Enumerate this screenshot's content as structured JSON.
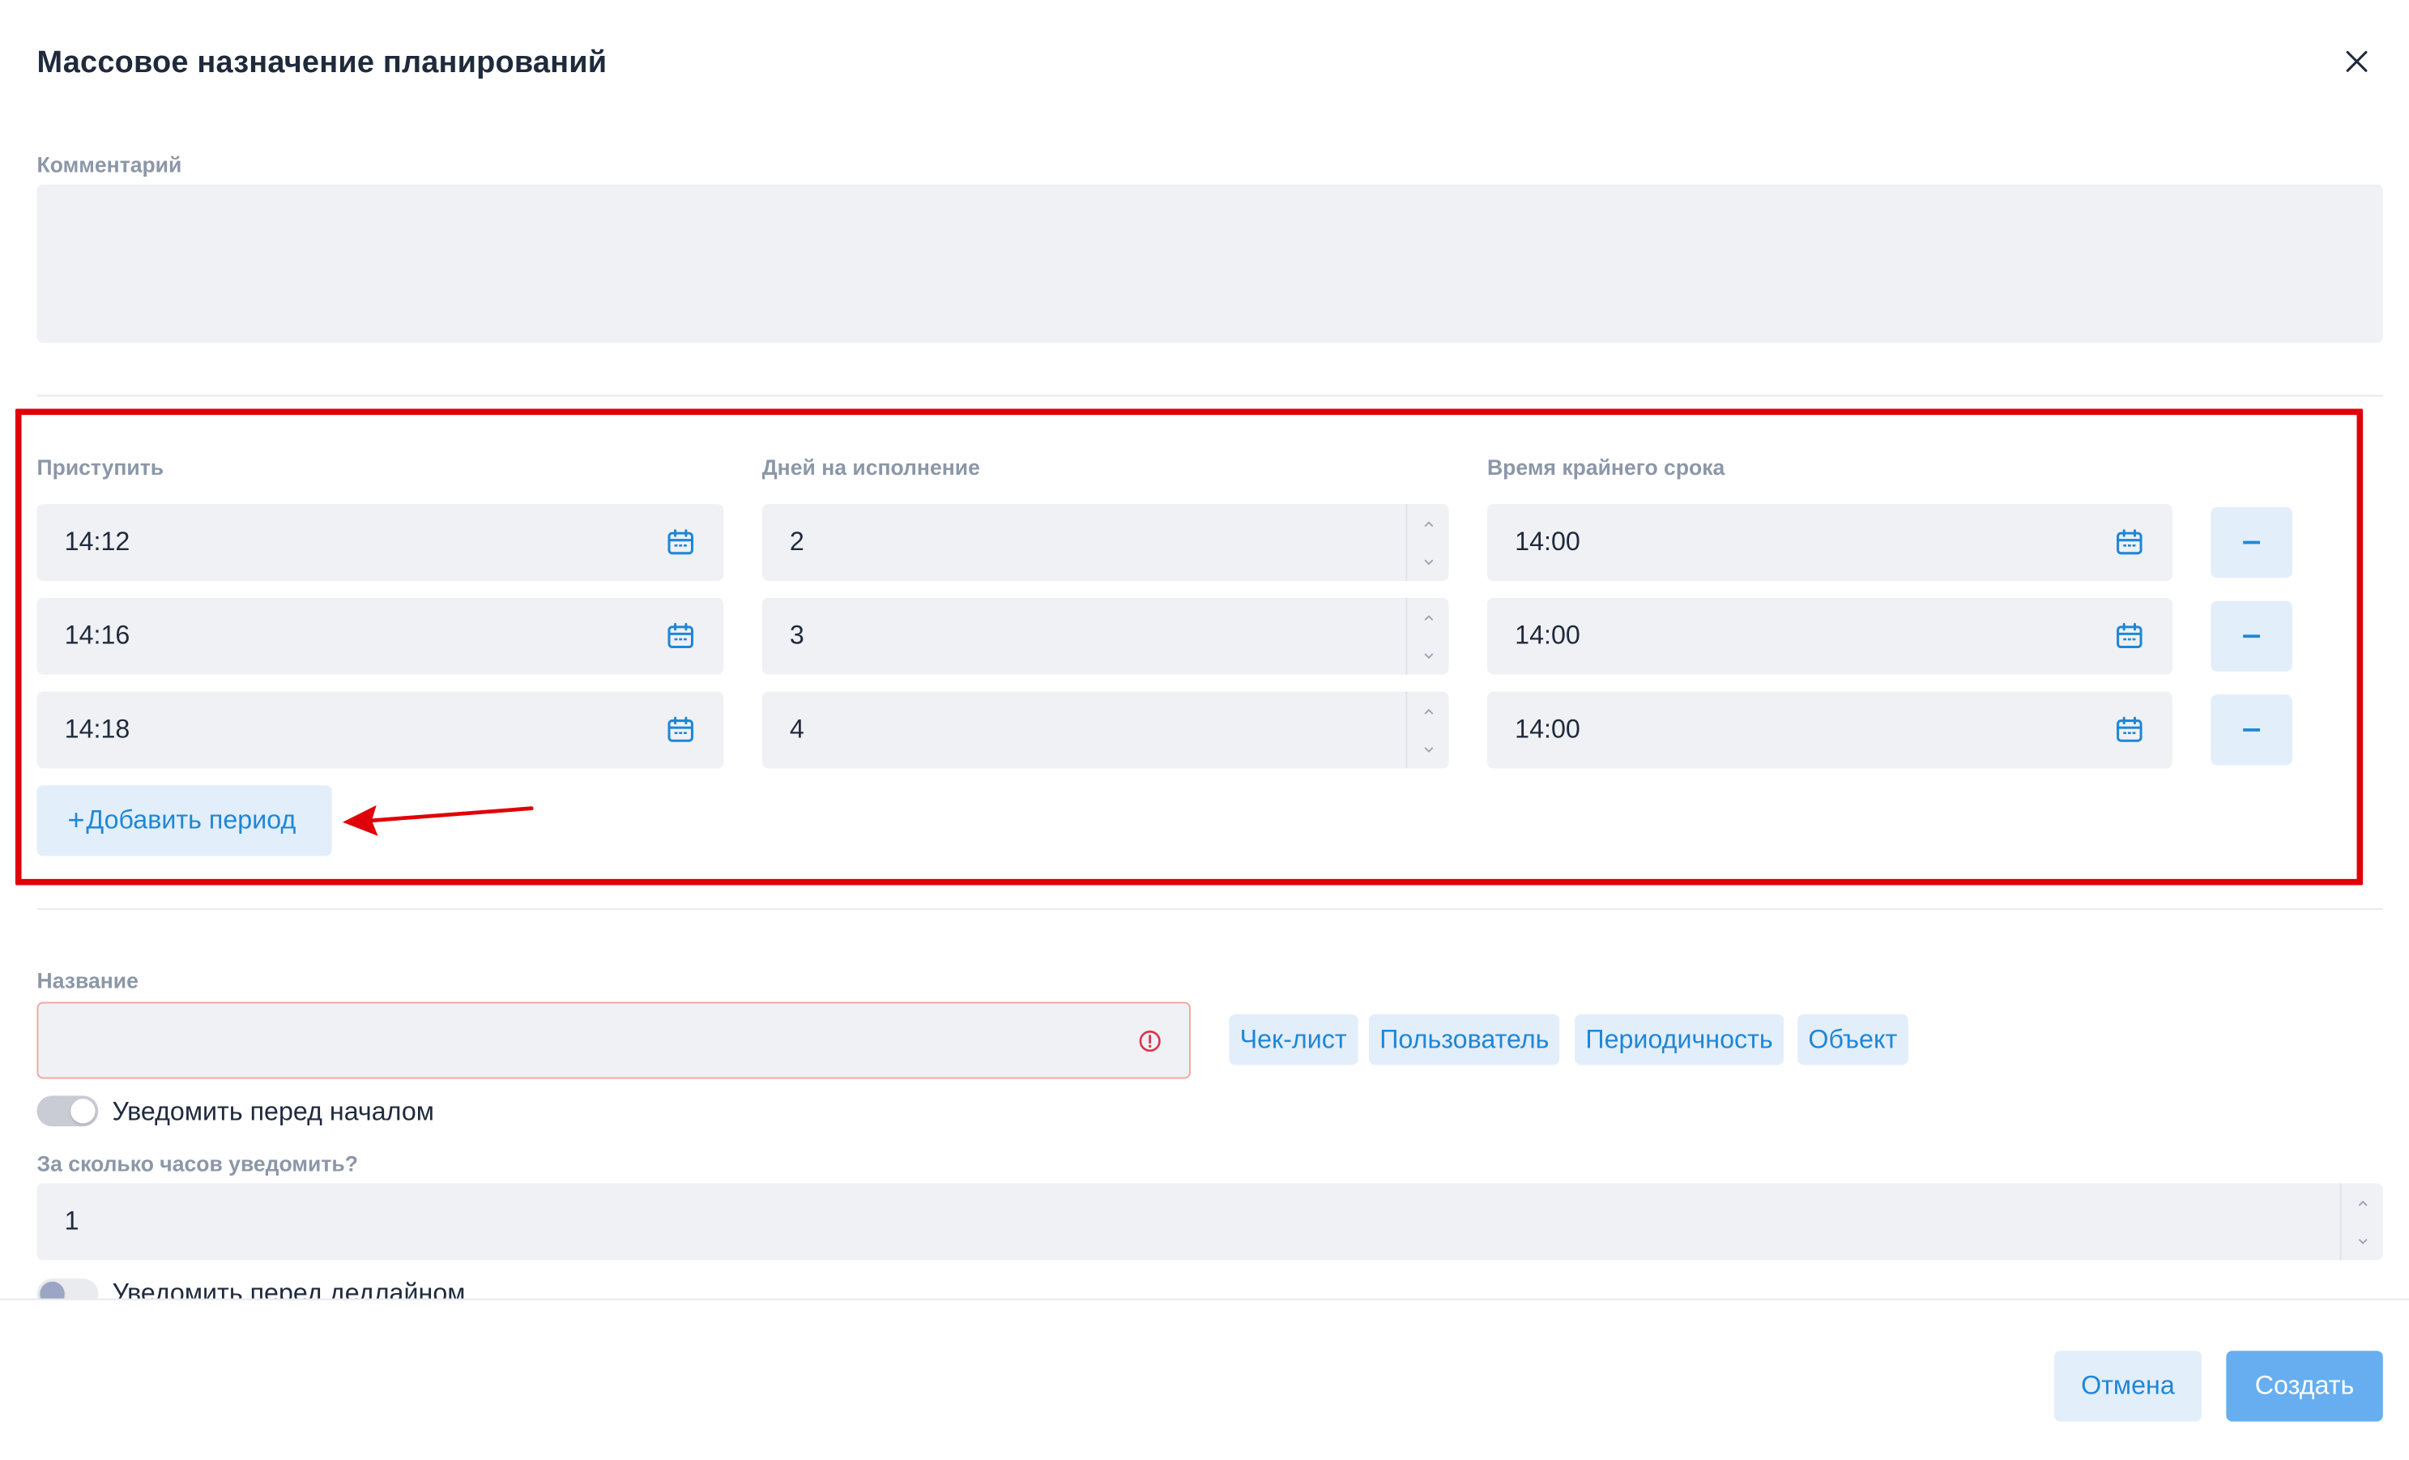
{
  "dialog": {
    "title": "Массовое назначение планирований",
    "close_icon": "close-icon"
  },
  "comment": {
    "label": "Комментарий",
    "value": ""
  },
  "periods": {
    "columns": {
      "start": "Приступить",
      "days": "Дней на исполнение",
      "deadline": "Время крайнего срока"
    },
    "rows": [
      {
        "start": "14:12",
        "days": "2",
        "deadline": "14:00"
      },
      {
        "start": "14:16",
        "days": "3",
        "deadline": "14:00"
      },
      {
        "start": "14:18",
        "days": "4",
        "deadline": "14:00"
      }
    ],
    "add_button": {
      "plus": "+",
      "label": "Добавить период"
    },
    "calendar_icon": "calendar-icon",
    "remove_icon": "minus-icon"
  },
  "name": {
    "label": "Название",
    "value": "",
    "state_icon": "warning-circle-icon",
    "tags": [
      "Чек-лист",
      "Пользователь",
      "Периодичность",
      "Объект"
    ]
  },
  "notify_before_start": {
    "label": "Уведомить перед началом",
    "enabled": true
  },
  "notify_hours": {
    "label": "За сколько часов уведомить?",
    "value": "1"
  },
  "notify_before_deadline": {
    "label": "Уведомить перед дедлайном",
    "enabled": false
  },
  "footer": {
    "cancel": "Отмена",
    "create": "Создать"
  },
  "colors": {
    "accent": "#1f87d6",
    "annotation": "#e00009",
    "error_border": "#f2a5a5"
  }
}
